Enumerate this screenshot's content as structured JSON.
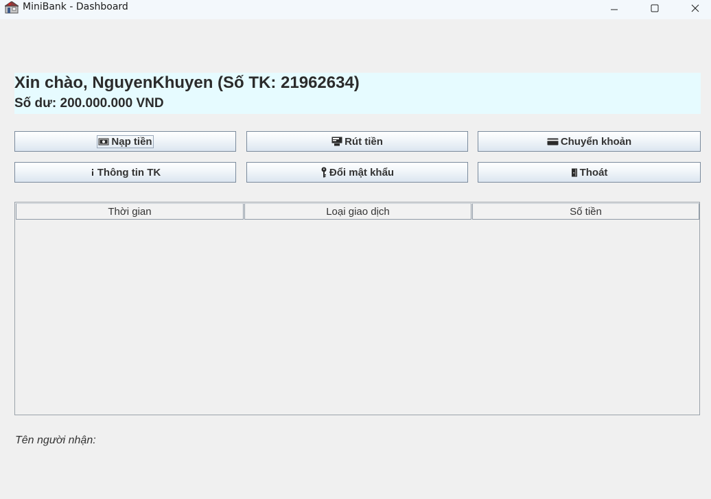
{
  "window": {
    "title": "MiniBank - Dashboard",
    "controls": {
      "minimize": "minimize-icon",
      "maximize": "maximize-icon",
      "close": "close-icon"
    }
  },
  "header": {
    "greeting": "Xin chào, NguyenKhuyen (Số TK: 21962634)",
    "balance": "Số dư: 200.000.000 VND",
    "background": "#e6fbff"
  },
  "actions": {
    "deposit": {
      "label": "Nạp tiền",
      "icon": "cash-icon"
    },
    "withdraw": {
      "label": "Rút tiền",
      "icon": "atm-icon"
    },
    "transfer": {
      "label": "Chuyển khoản",
      "icon": "card-icon"
    },
    "account_info": {
      "label": "Thông tin TK",
      "icon": "info-icon"
    },
    "change_password": {
      "label": "Đổi mật khẩu",
      "icon": "key-icon"
    },
    "logout": {
      "label": "Thoát",
      "icon": "door-icon"
    }
  },
  "transactions": {
    "columns": [
      "Thời gian",
      "Loại giao dịch",
      "Số tiền"
    ],
    "rows": []
  },
  "footer": {
    "recipient_label": "Tên người nhận:"
  }
}
